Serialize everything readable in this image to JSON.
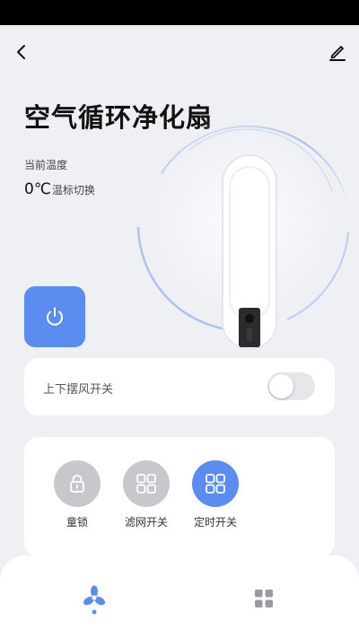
{
  "header": {
    "title": "空气循环净化扇"
  },
  "temperature": {
    "label": "当前温度",
    "value": "0℃",
    "unit_toggle_label": "温标切换"
  },
  "power": {
    "state": "on",
    "color": "#5b8df0"
  },
  "swing": {
    "label": "上下摆风开关",
    "enabled": false
  },
  "features": [
    {
      "label": "童锁",
      "icon": "lock-icon",
      "active": false
    },
    {
      "label": "滤网开关",
      "icon": "grid-icon",
      "active": false
    },
    {
      "label": "定时开关",
      "icon": "grid-icon",
      "active": true
    }
  ],
  "bottom_nav": {
    "items": [
      {
        "icon": "fan-icon",
        "active": true
      },
      {
        "icon": "apps-grid-icon",
        "active": false
      }
    ]
  },
  "colors": {
    "accent": "#5b8df0",
    "inactive": "#c7c8cb",
    "background": "#eef0f4"
  }
}
